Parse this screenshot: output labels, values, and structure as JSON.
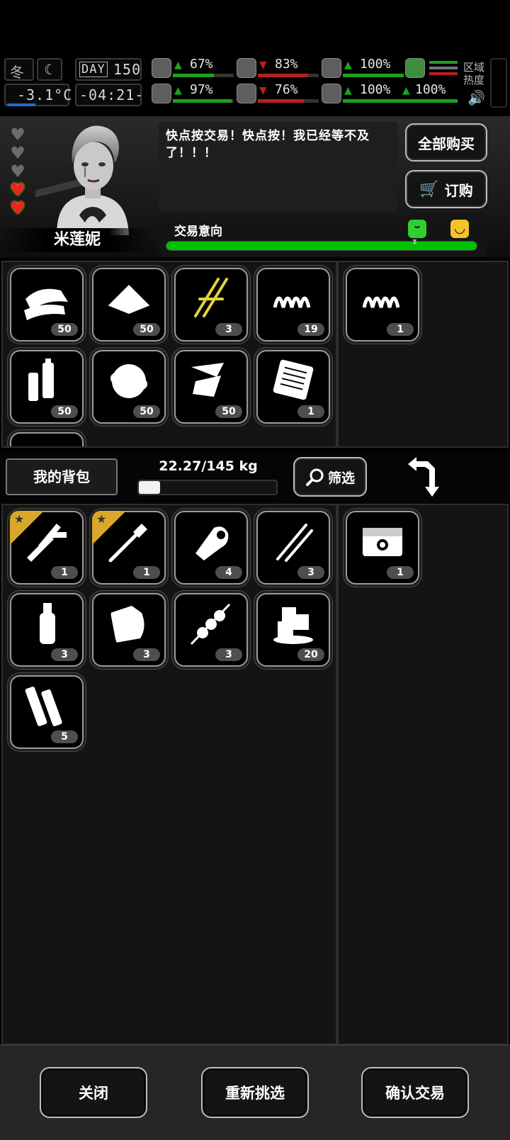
{
  "hud": {
    "season": "冬",
    "day_label": "DAY",
    "day_value": "150",
    "temperature": "-3.1°C",
    "clock": "-04:21-",
    "stats": [
      {
        "name": "health",
        "icon": "medkit-icon",
        "trend": "up",
        "percent": "67%",
        "fill": 0.67
      },
      {
        "name": "sleep",
        "icon": "moon-icon",
        "trend": "up",
        "percent": "83%",
        "fill": 0.83
      },
      {
        "name": "stomach",
        "icon": "stomach-icon",
        "trend": "up",
        "percent": "100%",
        "fill": 1.0
      },
      {
        "name": "mind",
        "icon": "brain-icon",
        "trend": "up",
        "percent": "97%",
        "fill": 0.97
      },
      {
        "name": "water",
        "icon": "droplet-icon",
        "trend": "down",
        "percent": "76%",
        "fill": 0.76
      },
      {
        "name": "mood",
        "icon": "heart-icon",
        "trend": "up",
        "percent": "100%",
        "fill": 1.0
      },
      {
        "name": "stamina",
        "icon": "flask-icon",
        "trend": "up",
        "percent": "100%",
        "fill": 1.0
      }
    ],
    "area_label": "区域热度"
  },
  "trader": {
    "name": "米莲妮",
    "hearts_total": 5,
    "hearts_filled": 2,
    "speech": "快点按交易！快点按！我已经等不及了！！！",
    "buy_all_label": "全部购买",
    "order_label": "订购",
    "intent_label": "交易意向",
    "intent_level": 1.0
  },
  "trader_items": [
    {
      "icon": "cloth-icon",
      "qty": "50"
    },
    {
      "icon": "powder-pile-icon",
      "qty": "50"
    },
    {
      "icon": "paperclip-icon",
      "qty": "3"
    },
    {
      "icon": "spring-icon",
      "qty": "19"
    },
    {
      "icon": "batteries-icon",
      "qty": "50"
    },
    {
      "icon": "cotton-icon",
      "qty": "50"
    },
    {
      "icon": "paper-scraps-icon",
      "qty": "50"
    },
    {
      "icon": "circuit-board-icon",
      "qty": "1"
    }
  ],
  "trader_offer": [
    {
      "icon": "spring-icon",
      "qty": "1"
    }
  ],
  "bag": {
    "title": "我的背包",
    "weight": "22.27/145 kg",
    "weight_fill": 0.1536,
    "filter_label": "筛选"
  },
  "bag_items": [
    {
      "icon": "knife-caliper-icon",
      "qty": "1",
      "starred": true
    },
    {
      "icon": "screwdriver-icon",
      "qty": "1",
      "starred": true
    },
    {
      "icon": "bandage-roll-icon",
      "qty": "4",
      "starred": false
    },
    {
      "icon": "lockpick-icon",
      "qty": "3",
      "starred": false
    },
    {
      "icon": "water-bottle-icon",
      "qty": "3",
      "starred": false
    },
    {
      "icon": "cloth-roll-icon",
      "qty": "3",
      "starred": false
    },
    {
      "icon": "meat-skewer-icon",
      "qty": "3",
      "starred": false
    },
    {
      "icon": "ice-cubes-icon",
      "qty": "20",
      "starred": false
    },
    {
      "icon": "splint-bandage-icon",
      "qty": "5",
      "starred": false
    }
  ],
  "bag_offer": [
    {
      "icon": "supply-crate-icon",
      "qty": "1"
    }
  ],
  "footer": {
    "close_label": "关闭",
    "reselect_label": "重新挑选",
    "confirm_label": "确认交易"
  },
  "colors": {
    "intent_bar": "#00c200",
    "heart_full": "#e22222",
    "star_badge": "#d9a729"
  }
}
